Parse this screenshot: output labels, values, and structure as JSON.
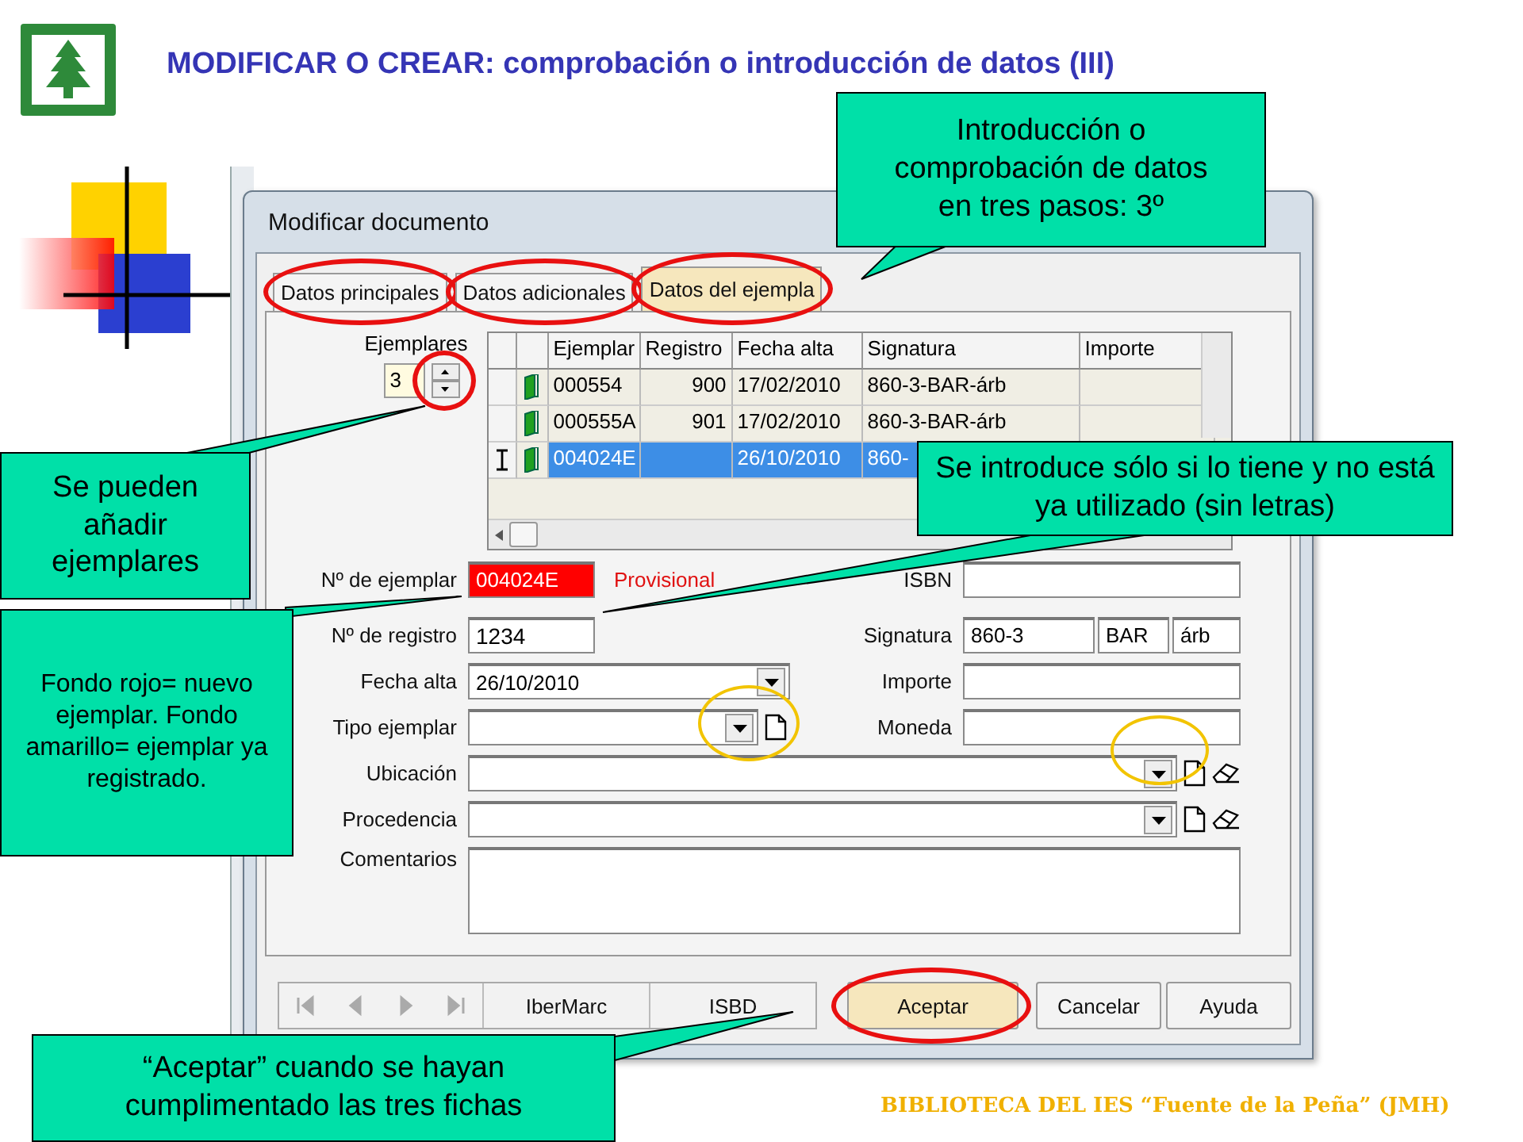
{
  "slide": {
    "title": "MODIFICAR O CREAR: comprobación o introducción de datos (III)",
    "footer": "BIBLIOTECA DEL IES “Fuente de la Peña” (JMH)"
  },
  "dialog": {
    "title": "Modificar documento",
    "tabs": [
      {
        "label": "Datos principales",
        "selected": false
      },
      {
        "label": "Datos adicionales",
        "selected": false
      },
      {
        "label": "Datos del ejempla",
        "selected": true
      }
    ],
    "copies": {
      "label": "Ejemplares",
      "value": "3"
    },
    "table": {
      "columns": [
        "Ejemplar",
        "Registro",
        "Fecha alta",
        "Signatura",
        "Importe"
      ],
      "rows": [
        {
          "current": false,
          "selected": false,
          "cells": [
            "000554",
            "900",
            "17/02/2010",
            "860-3-BAR-árb"
          ]
        },
        {
          "current": false,
          "selected": false,
          "cells": [
            "000555A",
            "901",
            "17/02/2010",
            "860-3-BAR-árb"
          ]
        },
        {
          "current": true,
          "selected": true,
          "cells": [
            "004024E",
            null,
            "26/10/2010",
            "860-"
          ]
        }
      ]
    },
    "copy_number": {
      "label": "Nº de ejemplar",
      "value": "004024E",
      "new": true,
      "status": "Provisional"
    },
    "register_number": {
      "label": "Nº de registro",
      "value": "1234"
    },
    "date": {
      "label": "Fecha alta",
      "value": "26/10/2010"
    },
    "copy_type": {
      "label": "Tipo ejemplar"
    },
    "location": {
      "label": "Ubicación"
    },
    "origin": {
      "label": "Procedencia"
    },
    "comments": {
      "label": "Comentarios"
    },
    "isbn": {
      "label": "ISBN"
    },
    "signature": {
      "label": "Signatura",
      "parts": [
        "860-3",
        "BAR",
        "árb"
      ]
    },
    "amount": {
      "label": "Importe"
    },
    "currency": {
      "label": "Moneda"
    },
    "format_buttons": [
      "IberMarc",
      "ISBD"
    ],
    "buttons": [
      {
        "label": "Aceptar",
        "focused": true
      },
      {
        "label": "Cancelar",
        "focused": false
      },
      {
        "label": "Ayuda",
        "focused": false
      }
    ]
  },
  "callouts": [
    {
      "text": "Introducción o comprobación de datos en tres pasos: 3º"
    },
    {
      "text": "Se pueden añadir ejemplares"
    },
    {
      "text": "Se introduce sólo si lo tiene y no está ya utilizado (sin letras)"
    },
    {
      "text": "Fondo rojo= nuevo ejemplar. Fondo amarillo= ejemplar ya registrado."
    },
    {
      "text": "“Aceptar” cuando se hayan cumplimentado las tres fichas"
    }
  ]
}
